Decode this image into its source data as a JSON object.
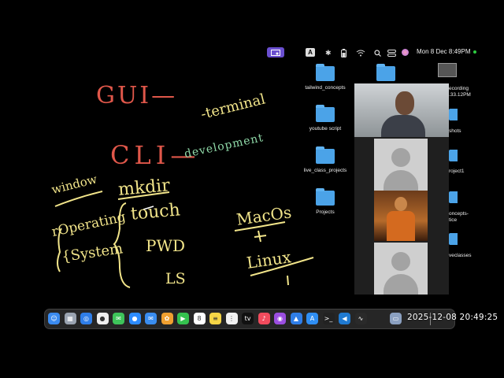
{
  "menubar": {
    "apple_glyph": "",
    "input_source": "A",
    "clock": "Mon 8 Dec  8:49PM"
  },
  "whiteboard": {
    "gui": "GUI—",
    "cli": "CLI—",
    "terminal": "-terminal",
    "development": "development",
    "window": "window",
    "mkdir": "mkdir",
    "touch": "touch",
    "pwd": "PWD",
    "ls": "LS",
    "operating": "rOperating",
    "system": "{System",
    "macos": "MacOs",
    "linux": "Linux"
  },
  "desktop": {
    "folders": [
      {
        "label": "tailwind_concepts"
      },
      {
        "label": "youtube script"
      },
      {
        "label": "live_class_projects"
      },
      {
        "label": "Projects"
      }
    ],
    "partial_labels": [
      "ecording",
      ".33.12PM",
      "shots",
      "roject1",
      "oncepts-",
      "tice",
      "veclasses"
    ]
  },
  "dock": {
    "apps": [
      {
        "name": "finder-icon",
        "color": "#3b8bf0",
        "glyph": "☺"
      },
      {
        "name": "launchpad-icon",
        "color": "#9aa3b0",
        "glyph": "▦"
      },
      {
        "name": "safari-icon",
        "color": "#2f7ee8",
        "glyph": "◎"
      },
      {
        "name": "chrome-icon",
        "color": "#eeeeee",
        "glyph": "●"
      },
      {
        "name": "messages-icon",
        "color": "#3ec45a",
        "glyph": "✉"
      },
      {
        "name": "zoom-icon",
        "color": "#2d8cff",
        "glyph": "●"
      },
      {
        "name": "mail-icon",
        "color": "#3a8df0",
        "glyph": "✉"
      },
      {
        "name": "photos-icon",
        "color": "#f0a030",
        "glyph": "✿"
      },
      {
        "name": "facetime-icon",
        "color": "#35c24f",
        "glyph": "▶"
      },
      {
        "name": "calendar-icon",
        "color": "#ffffff",
        "glyph": "8"
      },
      {
        "name": "notes-icon",
        "color": "#f5d546",
        "glyph": "≡"
      },
      {
        "name": "reminders-icon",
        "color": "#f2f2f2",
        "glyph": "⋮"
      },
      {
        "name": "tv-icon",
        "color": "#111111",
        "glyph": "tv"
      },
      {
        "name": "music-icon",
        "color": "#f24b5d",
        "glyph": "♪"
      },
      {
        "name": "podcasts-icon",
        "color": "#9b4ee0",
        "glyph": "◉"
      },
      {
        "name": "keynote-icon",
        "color": "#2f7ee8",
        "glyph": "▲"
      },
      {
        "name": "app-store-icon",
        "color": "#2f8ef3",
        "glyph": "A"
      },
      {
        "name": "terminal-icon",
        "color": "#222222",
        "glyph": ">_"
      },
      {
        "name": "vscode-icon",
        "color": "#1f7ad1",
        "glyph": "◀"
      },
      {
        "name": "activity-monitor-icon",
        "color": "#2a2a2a",
        "glyph": "∿"
      },
      {
        "name": "preview-icon",
        "color": "#8ba0c0",
        "glyph": "▭"
      }
    ]
  },
  "overlay": {
    "timestamp": "2025-12-08 20:49:25"
  }
}
